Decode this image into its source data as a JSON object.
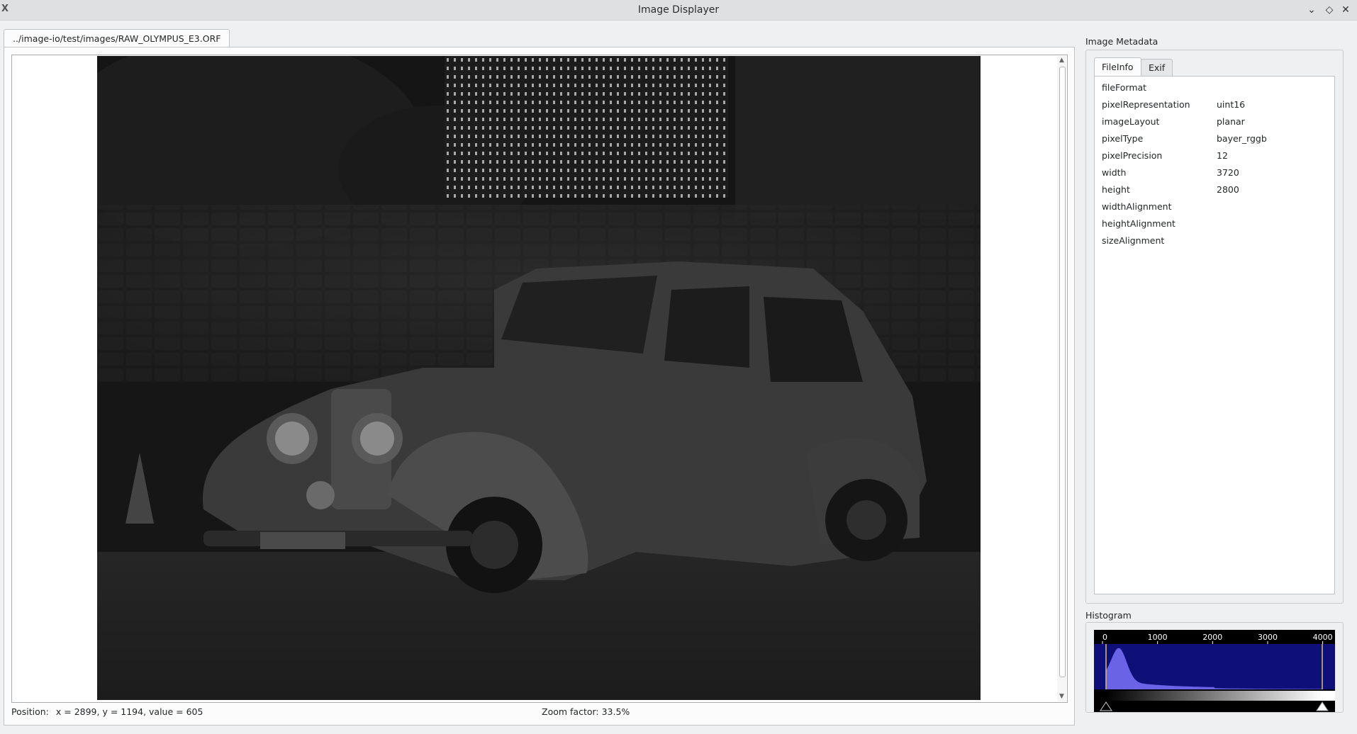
{
  "window": {
    "title": "Image Displayer"
  },
  "document_tab": {
    "label": "../image-io/test/images/RAW_OLYMPUS_E3.ORF"
  },
  "status": {
    "position_label": "Position:",
    "position_value": "x = 2899, y = 1194, value = 605",
    "zoom": "Zoom factor: 33.5%"
  },
  "metadata": {
    "group_title": "Image Metadata",
    "tabs": [
      {
        "label": "FileInfo",
        "active": true
      },
      {
        "label": "Exif",
        "active": false
      }
    ],
    "rows": [
      {
        "key": "fileFormat",
        "value": ""
      },
      {
        "key": "pixelRepresentation",
        "value": "uint16"
      },
      {
        "key": "imageLayout",
        "value": "planar"
      },
      {
        "key": "pixelType",
        "value": "bayer_rggb"
      },
      {
        "key": "pixelPrecision",
        "value": "12"
      },
      {
        "key": "width",
        "value": "3720"
      },
      {
        "key": "height",
        "value": "2800"
      },
      {
        "key": "widthAlignment",
        "value": ""
      },
      {
        "key": "heightAlignment",
        "value": ""
      },
      {
        "key": "sizeAlignment",
        "value": ""
      }
    ]
  },
  "histogram": {
    "group_title": "Histogram",
    "ticks": [
      "0",
      "1000",
      "2000",
      "3000",
      "4000"
    ],
    "range": [
      0,
      4095
    ],
    "fill_color": "#6b63e6",
    "background_color": "#0f0f7a"
  },
  "colors": {
    "window_bg": "#eff0f1",
    "titlebar_bg": "#dee0e2"
  }
}
